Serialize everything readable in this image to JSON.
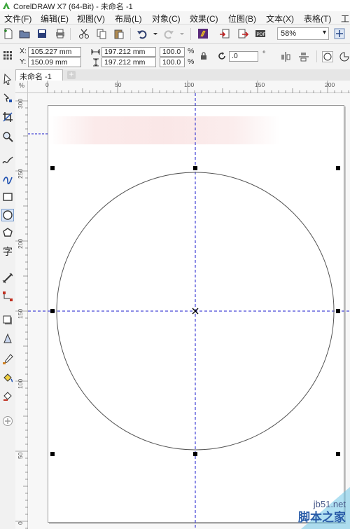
{
  "app": {
    "title": "CorelDRAW X7 (64-Bit) - 未命名 -1"
  },
  "menu": {
    "items": [
      "文件(F)",
      "编辑(E)",
      "视图(V)",
      "布局(L)",
      "对象(C)",
      "效果(C)",
      "位图(B)",
      "文本(X)",
      "表格(T)",
      "工"
    ]
  },
  "toolbar": {
    "icons": [
      "new-document-icon",
      "open-icon",
      "save-icon",
      "print-icon",
      "cut-icon",
      "copy-icon",
      "paste-icon",
      "undo-icon",
      "redo-icon",
      "search-content-icon",
      "import-icon",
      "export-icon",
      "publish-pdf-icon",
      "app-launcher-icon"
    ],
    "zoom_value": "58%"
  },
  "properties": {
    "x_label": "X:",
    "x_value": "105.227 mm",
    "y_label": "Y:",
    "y_value": "150.09 mm",
    "width_value": "197.212 mm",
    "height_value": "197.212 mm",
    "scale_x": "100.0",
    "scale_y": "100.0",
    "percent_sign": "%",
    "rotation_value": ".0",
    "degree_sign": "°"
  },
  "document": {
    "tab_label": "未命名 -1",
    "add_tab": "+"
  },
  "ruler": {
    "units_symbol": "%",
    "h_labels": [
      "0",
      "50",
      "100",
      "150",
      "200"
    ],
    "v_labels": [
      "300",
      "250",
      "200",
      "150",
      "100",
      "50",
      "0"
    ]
  },
  "watermark": {
    "site": "jb51.net",
    "name": "脚本之家"
  },
  "colors": {
    "guide": "#1a1acc",
    "selection_handle": "#000000",
    "page_border": "#9a9a9a"
  }
}
